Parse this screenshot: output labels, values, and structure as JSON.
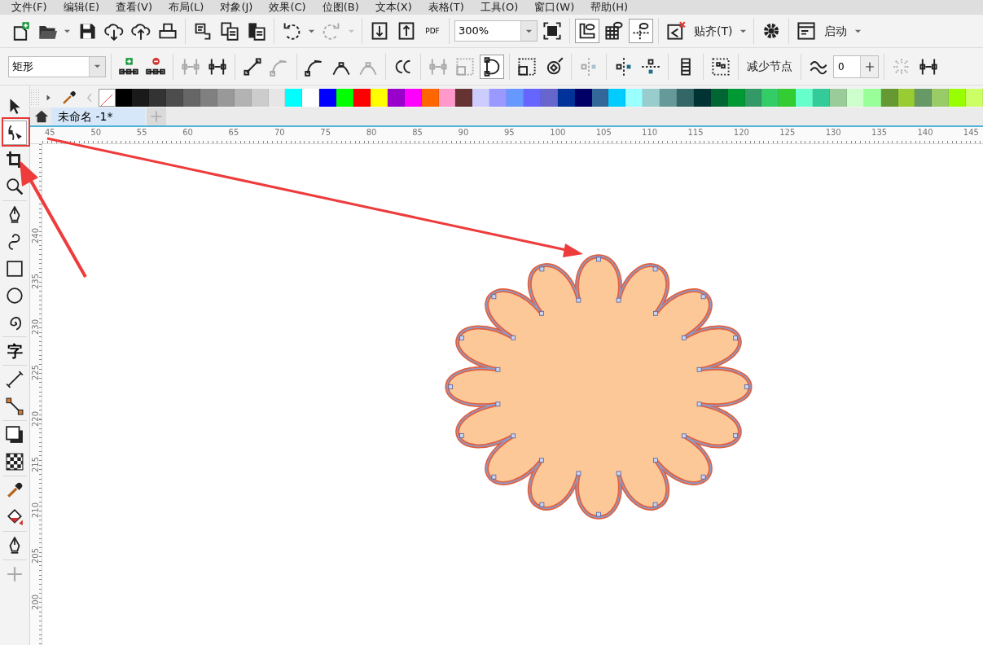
{
  "menu": [
    {
      "label": "文件(F)"
    },
    {
      "label": "编辑(E)"
    },
    {
      "label": "查看(V)"
    },
    {
      "label": "布局(L)"
    },
    {
      "label": "对象(J)"
    },
    {
      "label": "效果(C)"
    },
    {
      "label": "位图(B)"
    },
    {
      "label": "文本(X)"
    },
    {
      "label": "表格(T)"
    },
    {
      "label": "工具(O)"
    },
    {
      "label": "窗口(W)"
    },
    {
      "label": "帮助(H)"
    }
  ],
  "standard_toolbar": [
    [
      {
        "kind": "icon",
        "disabled": false,
        "pressed": false
      },
      {
        "kind": "icon",
        "disabled": false,
        "pressed": false
      },
      {
        "kind": "caret",
        "disabled": false
      },
      {
        "kind": "icon",
        "disabled": false,
        "pressed": false
      },
      {
        "kind": "icon",
        "disabled": false,
        "pressed": false
      },
      {
        "kind": "icon",
        "disabled": false,
        "pressed": false
      },
      {
        "kind": "icon",
        "disabled": false,
        "pressed": false
      }
    ],
    [
      {
        "kind": "icon",
        "disabled": false,
        "pressed": false
      },
      {
        "kind": "icon",
        "disabled": false,
        "pressed": false
      },
      {
        "kind": "icon",
        "disabled": false,
        "pressed": false
      }
    ],
    [
      {
        "kind": "icon",
        "disabled": false,
        "pressed": false
      },
      {
        "kind": "caret",
        "disabled": false
      },
      {
        "kind": "icon",
        "disabled": true,
        "pressed": false
      },
      {
        "kind": "caret",
        "disabled": true
      }
    ],
    [
      {
        "kind": "icon",
        "disabled": false,
        "pressed": false
      },
      {
        "kind": "icon",
        "disabled": false,
        "pressed": false
      },
      {
        "kind": "pdf",
        "text": "PDF",
        "disabled": false
      }
    ],
    [
      {
        "kind": "combo",
        "value": "300%"
      },
      {
        "kind": "icon",
        "disabled": false,
        "pressed": false
      }
    ],
    [
      {
        "kind": "icon",
        "disabled": false,
        "pressed": true
      },
      {
        "kind": "icon",
        "disabled": false,
        "pressed": false
      },
      {
        "kind": "icon",
        "disabled": false,
        "pressed": true
      }
    ],
    [
      {
        "kind": "icon",
        "disabled": false,
        "pressed": false
      },
      {
        "kind": "label",
        "text": "贴齐(T)"
      },
      {
        "kind": "caret",
        "disabled": false
      }
    ],
    [
      {
        "kind": "icon",
        "disabled": false,
        "pressed": false
      }
    ],
    [
      {
        "kind": "icon",
        "disabled": false,
        "pressed": false
      },
      {
        "kind": "label",
        "text": "启动"
      },
      {
        "kind": "caret",
        "disabled": false
      }
    ]
  ],
  "property_bar": [
    [
      {
        "kind": "combo",
        "value": "矩形"
      }
    ],
    [
      {
        "kind": "icon",
        "disabled": false,
        "pressed": false
      },
      {
        "kind": "icon",
        "disabled": false,
        "pressed": false
      }
    ],
    [
      {
        "kind": "icon",
        "disabled": true,
        "pressed": false
      },
      {
        "kind": "icon",
        "disabled": false,
        "pressed": false
      }
    ],
    [
      {
        "kind": "icon",
        "disabled": false,
        "pressed": false
      },
      {
        "kind": "icon",
        "disabled": true,
        "pressed": false
      }
    ],
    [
      {
        "kind": "icon",
        "disabled": false,
        "pressed": false
      },
      {
        "kind": "icon",
        "disabled": false,
        "pressed": false
      },
      {
        "kind": "icon",
        "disabled": true,
        "pressed": false
      }
    ],
    [
      {
        "kind": "icon",
        "disabled": false,
        "pressed": false
      }
    ],
    [
      {
        "kind": "icon",
        "disabled": true,
        "pressed": false
      },
      {
        "kind": "icon",
        "disabled": true,
        "pressed": false
      },
      {
        "kind": "icon",
        "disabled": false,
        "pressed": true
      }
    ],
    [
      {
        "kind": "icon",
        "disabled": false,
        "pressed": false
      },
      {
        "kind": "icon",
        "disabled": false,
        "pressed": false
      }
    ],
    [
      {
        "kind": "icon",
        "disabled": true,
        "pressed": false
      }
    ],
    [
      {
        "kind": "icon",
        "disabled": false,
        "pressed": false
      },
      {
        "kind": "icon",
        "disabled": false,
        "pressed": false
      }
    ],
    [
      {
        "kind": "icon",
        "disabled": false,
        "pressed": false
      }
    ],
    [
      {
        "kind": "icon",
        "disabled": false,
        "pressed": false
      }
    ],
    [
      {
        "kind": "label",
        "text": "减少节点"
      }
    ],
    [
      {
        "kind": "icon",
        "disabled": false,
        "pressed": false
      },
      {
        "kind": "spin",
        "value": "0"
      }
    ],
    [
      {
        "kind": "icon",
        "disabled": true,
        "pressed": false
      },
      {
        "kind": "icon",
        "disabled": false,
        "pressed": false
      }
    ]
  ],
  "toolbox": [
    [
      {
        "selected": false
      },
      {
        "selected": true
      },
      {
        "selected": false
      },
      {
        "selected": false
      }
    ],
    [
      {
        "selected": false
      },
      {
        "selected": false
      },
      {
        "selected": false
      },
      {
        "selected": false
      },
      {
        "selected": false
      }
    ],
    [
      {
        "selected": false,
        "glyph": "字"
      }
    ],
    [
      {
        "selected": false
      },
      {
        "selected": false
      }
    ],
    [
      {
        "selected": false
      },
      {
        "selected": false
      }
    ],
    [
      {
        "selected": false
      },
      {
        "selected": false
      }
    ],
    [
      {
        "selected": false
      }
    ],
    [
      {
        "selected": false
      }
    ]
  ],
  "palette": [
    {
      "color": "#000000"
    },
    {
      "color": "#1a1a1a"
    },
    {
      "color": "#333333"
    },
    {
      "color": "#4d4d4d"
    },
    {
      "color": "#666666"
    },
    {
      "color": "#808080"
    },
    {
      "color": "#999999"
    },
    {
      "color": "#b3b3b3"
    },
    {
      "color": "#cccccc"
    },
    {
      "color": "#e6e6e6"
    },
    {
      "color": "#00ffff"
    },
    {
      "color": "#ffffff"
    },
    {
      "color": "#0000ff"
    },
    {
      "color": "#00ff00"
    },
    {
      "color": "#ff0000"
    },
    {
      "color": "#ffff00"
    },
    {
      "color": "#9900cc"
    },
    {
      "color": "#ff00ff"
    },
    {
      "color": "#ff6600"
    },
    {
      "color": "#ff99cc"
    },
    {
      "color": "#663333"
    },
    {
      "color": "#ccccff"
    },
    {
      "color": "#9999ff"
    },
    {
      "color": "#6699ff"
    },
    {
      "color": "#6666ff"
    },
    {
      "color": "#6666cc"
    },
    {
      "color": "#003399"
    },
    {
      "color": "#000066"
    },
    {
      "color": "#336699"
    },
    {
      "color": "#00ccff"
    },
    {
      "color": "#99ffff"
    },
    {
      "color": "#99cccc"
    },
    {
      "color": "#669999"
    },
    {
      "color": "#336666"
    },
    {
      "color": "#003333"
    },
    {
      "color": "#006633"
    },
    {
      "color": "#009933"
    },
    {
      "color": "#339966"
    },
    {
      "color": "#33cc66"
    },
    {
      "color": "#33cc33"
    },
    {
      "color": "#66ffcc"
    },
    {
      "color": "#33cc99"
    },
    {
      "color": "#99cc99"
    },
    {
      "color": "#ccffcc"
    },
    {
      "color": "#99ff99"
    },
    {
      "color": "#669933"
    },
    {
      "color": "#99cc33"
    },
    {
      "color": "#669966"
    },
    {
      "color": "#99cc66"
    },
    {
      "color": "#99ff00"
    },
    {
      "color": "#ccff66"
    }
  ],
  "document_tabs": [
    {
      "label": "未命名 -1*",
      "selected": true
    }
  ],
  "horizontal_ruler": [
    "45",
    "50",
    "55",
    "60",
    "65",
    "70",
    "75",
    "80",
    "85",
    "90",
    "95",
    "100",
    "105",
    "110",
    "115",
    "120",
    "125",
    "130",
    "135",
    "140",
    "145"
  ],
  "vertical_ruler": [
    "240",
    "235",
    "230",
    "225",
    "220",
    "215",
    "210",
    "205",
    "200"
  ]
}
